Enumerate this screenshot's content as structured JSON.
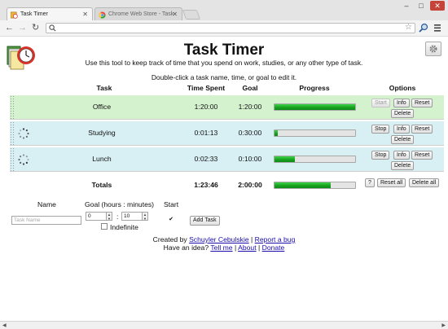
{
  "browser": {
    "tabs": [
      {
        "title": "Task Timer",
        "active": true
      },
      {
        "title": "Chrome Web Store - Task",
        "active": false
      }
    ],
    "address": {
      "value": "",
      "placeholder": ""
    }
  },
  "page": {
    "title": "Task Timer",
    "subtitle": "Use this tool to keep track of time that you spend on work, studies, or any other type of task.",
    "hint": "Double-click a task name, time, or goal to edit it."
  },
  "table": {
    "headers": {
      "task": "Task",
      "time_spent": "Time Spent",
      "goal": "Goal",
      "progress": "Progress",
      "options": "Options"
    },
    "rows": [
      {
        "name": "Office",
        "time": "1:20:00",
        "goal": "1:20:00",
        "progress": 1.0,
        "running": false,
        "color": "#d5f2cf",
        "buttons": {
          "toggle": "Start",
          "info": "Info",
          "reset": "Reset",
          "delete": "Delete"
        }
      },
      {
        "name": "Studying",
        "time": "0:01:13",
        "goal": "0:30:00",
        "progress": 0.04,
        "running": true,
        "color": "#d8eff3",
        "buttons": {
          "toggle": "Stop",
          "info": "Info",
          "reset": "Reset",
          "delete": "Delete"
        }
      },
      {
        "name": "Lunch",
        "time": "0:02:33",
        "goal": "0:10:00",
        "progress": 0.25,
        "running": true,
        "color": "#d8eff3",
        "buttons": {
          "toggle": "Stop",
          "info": "Info",
          "reset": "Reset",
          "delete": "Delete"
        }
      }
    ],
    "totals": {
      "label": "Totals",
      "time": "1:23:46",
      "goal": "2:00:00",
      "progress": 0.7,
      "buttons": {
        "help": "?",
        "reset_all": "Reset all",
        "delete_all": "Delete all"
      }
    }
  },
  "add_form": {
    "name_label": "Name",
    "goal_label": "Goal (hours : minutes)",
    "start_label": "Start",
    "name_placeholder": "Task Name",
    "hours_value": "0",
    "minutes_value": "10",
    "separator": ":",
    "indefinite_label": "Indefinite",
    "start_checked": true,
    "indefinite_checked": false,
    "add_button": "Add Task"
  },
  "footer": {
    "created_by": "Created by",
    "author": "Schuyler Cebulskie",
    "sep1": "|",
    "report_bug": "Report a bug",
    "have_idea": "Have an idea?",
    "tell_me": "Tell me",
    "sep2": "|",
    "about": "About",
    "sep3": "|",
    "donate": "Donate"
  },
  "colors": {
    "progress_fill": "#17a21f",
    "link": "#1a0dab",
    "row_done": "#d5f2cf",
    "row_running": "#d8eff3"
  }
}
